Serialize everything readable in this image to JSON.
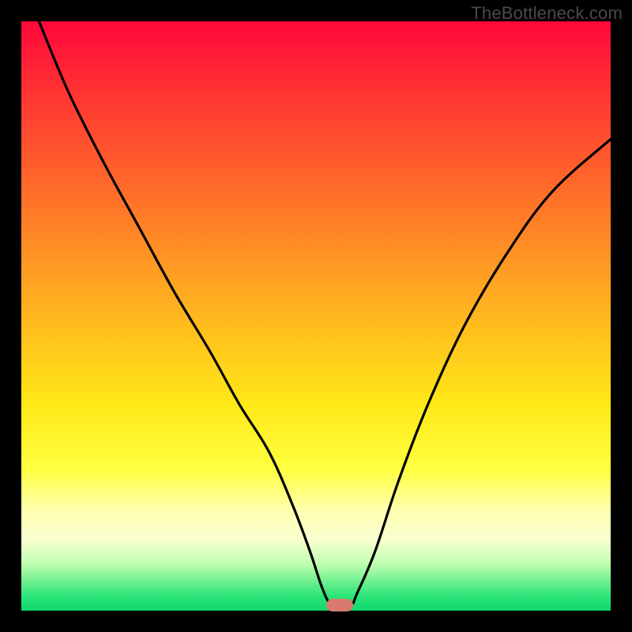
{
  "watermark": "TheBottleneck.com",
  "chart_data": {
    "type": "line",
    "title": "",
    "xlabel": "",
    "ylabel": "",
    "xlim": [
      0,
      100
    ],
    "ylim": [
      0,
      100
    ],
    "series": [
      {
        "name": "bottleneck-curve",
        "x": [
          3,
          8,
          14,
          20,
          26,
          32,
          37,
          42,
          46,
          49,
          51,
          52.5,
          54,
          56,
          57,
          60,
          64,
          69,
          75,
          82,
          90,
          100
        ],
        "values": [
          100,
          88,
          76,
          65,
          54,
          44,
          35,
          27,
          18,
          10,
          4,
          1,
          1,
          1,
          3,
          10,
          22,
          35,
          48,
          60,
          71,
          80
        ]
      }
    ],
    "marker": {
      "x": 54,
      "y": 1
    },
    "gradient_stops": [
      {
        "pct": 0,
        "color": "#ff073a"
      },
      {
        "pct": 12,
        "color": "#ff3333"
      },
      {
        "pct": 28,
        "color": "#ff6a2a"
      },
      {
        "pct": 48,
        "color": "#ffb020"
      },
      {
        "pct": 65,
        "color": "#ffe817"
      },
      {
        "pct": 76,
        "color": "#ffff40"
      },
      {
        "pct": 83,
        "color": "#ffffb0"
      },
      {
        "pct": 88,
        "color": "#f8ffd0"
      },
      {
        "pct": 92,
        "color": "#c0ffb0"
      },
      {
        "pct": 95,
        "color": "#70f090"
      },
      {
        "pct": 97.5,
        "color": "#2de57a"
      },
      {
        "pct": 100,
        "color": "#0fd66a"
      }
    ]
  }
}
